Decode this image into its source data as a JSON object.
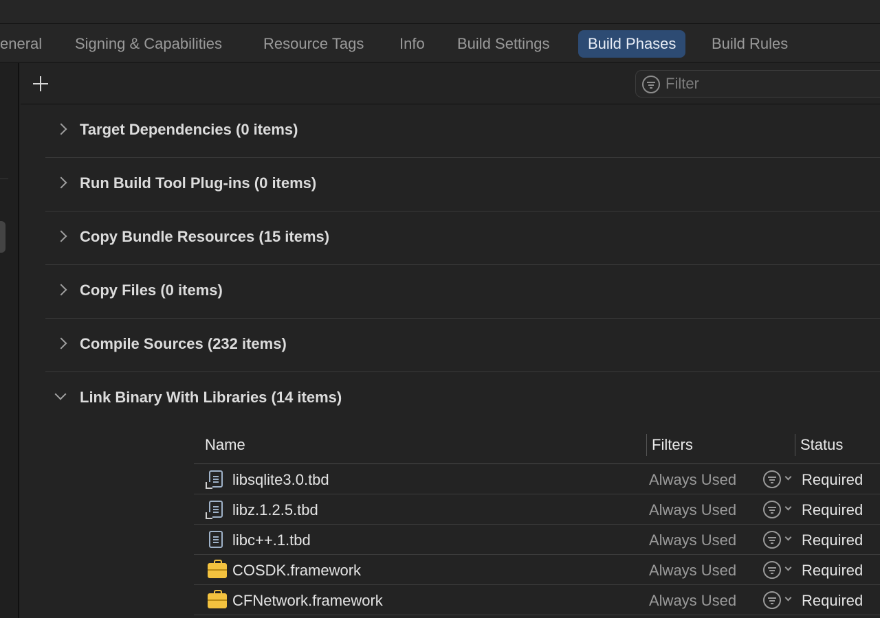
{
  "tabs": [
    {
      "label": "eneral",
      "active": false
    },
    {
      "label": "Signing & Capabilities",
      "active": false
    },
    {
      "label": "Resource Tags",
      "active": false
    },
    {
      "label": "Info",
      "active": false
    },
    {
      "label": "Build Settings",
      "active": false
    },
    {
      "label": "Build Phases",
      "active": true
    },
    {
      "label": "Build Rules",
      "active": false
    }
  ],
  "toolbar": {
    "add_icon": "plus-icon",
    "filter_icon": "filter-icon",
    "filter_placeholder": "Filter",
    "filter_value": ""
  },
  "phases": [
    {
      "title": "Target Dependencies (0 items)",
      "expanded": false
    },
    {
      "title": "Run Build Tool Plug-ins (0 items)",
      "expanded": false
    },
    {
      "title": "Copy Bundle Resources (15 items)",
      "expanded": false
    },
    {
      "title": "Copy Files (0 items)",
      "expanded": false
    },
    {
      "title": "Compile Sources (232 items)",
      "expanded": false
    },
    {
      "title": "Link Binary With Libraries (14 items)",
      "expanded": true
    }
  ],
  "libraries": {
    "columns": {
      "name": "Name",
      "filters": "Filters",
      "status": "Status"
    },
    "rows": [
      {
        "icon": "tbd-file-alias-icon",
        "name": "libsqlite3.0.tbd",
        "filter": "Always Used",
        "status": "Required"
      },
      {
        "icon": "tbd-file-alias-icon",
        "name": "libz.1.2.5.tbd",
        "filter": "Always Used",
        "status": "Required"
      },
      {
        "icon": "tbd-file-icon",
        "name": "libc++.1.tbd",
        "filter": "Always Used",
        "status": "Required"
      },
      {
        "icon": "framework-toolbox-icon",
        "name": "COSDK.framework",
        "filter": "Always Used",
        "status": "Required"
      },
      {
        "icon": "framework-toolbox-icon",
        "name": "CFNetwork.framework",
        "filter": "Always Used",
        "status": "Required"
      }
    ]
  },
  "colors": {
    "background": "#232323",
    "active_tab": "#2d4b73",
    "framework_icon": "#f3c23f"
  }
}
